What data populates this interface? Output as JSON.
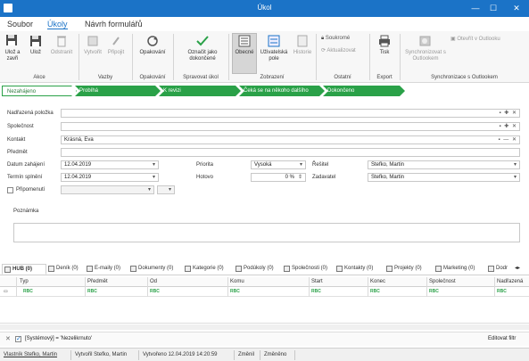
{
  "window": {
    "title": "Úkol",
    "minimize": "—",
    "maximize": "☐",
    "close": "✕"
  },
  "menu_tabs": [
    "Soubor",
    "Úkoly",
    "Návrh formulářů"
  ],
  "ribbon": {
    "buttons": {
      "save_close": "Ulož a zavři",
      "save": "Ulož",
      "remove": "Odstranit",
      "create": "Vytvořit",
      "attach": "Připojit",
      "repeat": "Opakování",
      "mark_done": "Označit jako dokončené",
      "general": "Obecné",
      "user_fields": "Uživatelská pole",
      "history": "Historie",
      "private": "Soukromé",
      "update": "Aktualizovat",
      "print": "Tisk",
      "sync_outlook": "Synchronizovat s Outlookem",
      "open_outlook": "Otevřít v Outlooku"
    },
    "groups": [
      "Akce",
      "Vazby",
      "Opakování",
      "Spravovat úkol",
      "Zobrazení",
      "Ostatní",
      "Export",
      "Synchronizace s Outlookem"
    ]
  },
  "workflow": [
    "Nezahájeno",
    "Probíhá",
    "K revizi",
    "Čeká se na někoho dalšího",
    "Dokončeno"
  ],
  "form": {
    "parent_label": "Nadřazená položka",
    "company_label": "Společnost",
    "contact_label": "Kontakt",
    "contact_value": "Krásná, Eva",
    "subject_label": "Předmět",
    "start_label": "Datum zahájení",
    "start_value": "12.04.2019",
    "due_label": "Termín splnění",
    "due_value": "12.04.2019",
    "reminder_label": "Připomenutí",
    "priority_label": "Priorita",
    "priority_value": "Vysoká",
    "done_label": "Hotovo",
    "done_value": "0 %",
    "solver_label": "Řešitel",
    "solver_value": "Stefko, Martin",
    "assigner_label": "Zadavatel",
    "assigner_value": "Stefko, Martin",
    "notes_label": "Poznámka"
  },
  "bottom_tabs": [
    "HUB (0)",
    "Deník (0)",
    "E-maily (0)",
    "Dokumenty (0)",
    "Kategorie (0)",
    "Podúkoly (0)",
    "Společnosti (0)",
    "Kontakty (0)",
    "Projekty (0)",
    "Marketing (0)",
    "Dodr"
  ],
  "grid": {
    "columns": [
      "Typ",
      "Předmět",
      "Od",
      "Komu",
      "Start",
      "Konec",
      "Společnost",
      "Nadřazená"
    ],
    "filter_marker": "RBC"
  },
  "filter_bar": {
    "text": "[Systémový] = 'Nezelikrnuto'",
    "edit": "Editovat filtr"
  },
  "status_bar": {
    "user": "Vlastník Stefko, Martin",
    "created_by": "Vytvořil Stefko, Martin",
    "created_on": "Vytvořeno 12.04.2019 14:20:59",
    "changed": "Změnil",
    "changed_on": "Změněno"
  }
}
